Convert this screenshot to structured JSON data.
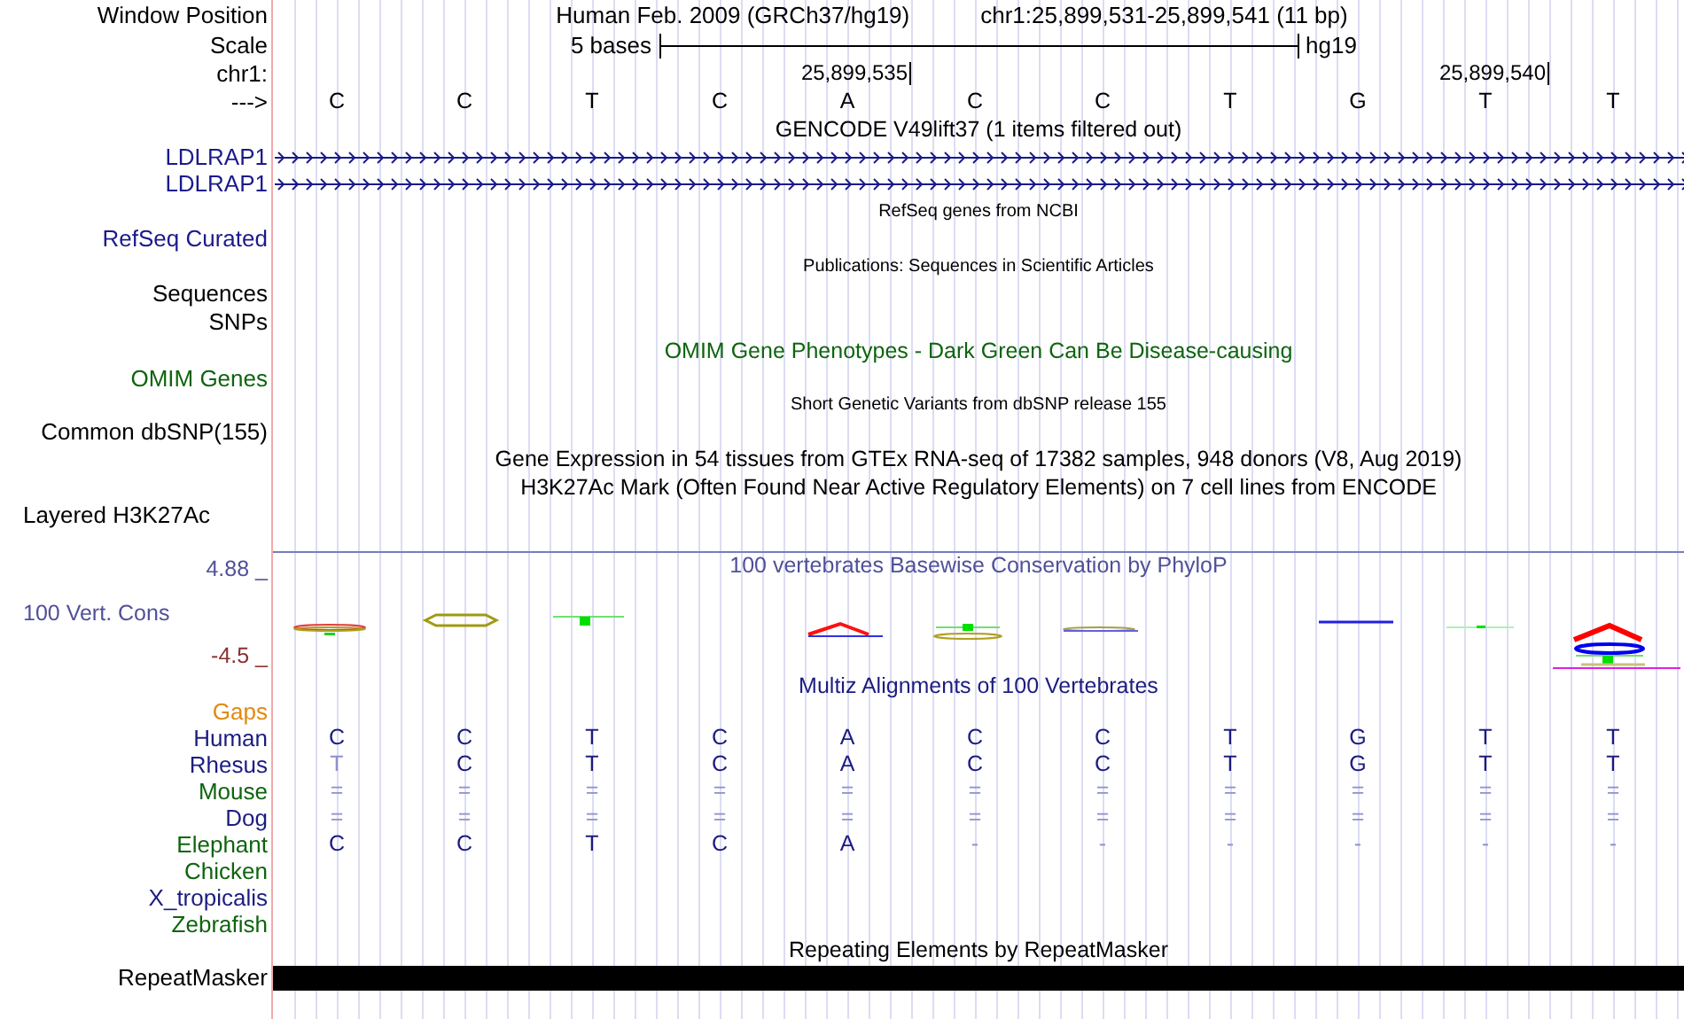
{
  "header": {
    "position_label": "Window Position",
    "assembly": "Human Feb. 2009 (GRCh37/hg19)",
    "range": "chr1:25,899,531-25,899,541 (11 bp)",
    "scale_label": "Scale",
    "scale_text": "5 bases",
    "scale_assembly": "hg19",
    "chrom_label": "chr1:",
    "strand_label": "--->"
  },
  "bases": [
    {
      "base": "C"
    },
    {
      "base": "C"
    },
    {
      "base": "T"
    },
    {
      "base": "C"
    },
    {
      "base": "A",
      "coordinate": "25,899,535"
    },
    {
      "base": "C"
    },
    {
      "base": "C"
    },
    {
      "base": "T"
    },
    {
      "base": "G"
    },
    {
      "base": "T",
      "coordinate": "25,899,540"
    },
    {
      "base": "T"
    }
  ],
  "gencode": {
    "title": "GENCODE V49lift37 (1 items filtered out)",
    "genes": [
      {
        "name": "LDLRAP1"
      },
      {
        "name": "LDLRAP1"
      }
    ]
  },
  "refseq": {
    "title": "RefSeq genes from NCBI",
    "label": "RefSeq Curated"
  },
  "publications": {
    "title": "Publications: Sequences in Scientific Articles",
    "labels": [
      "Sequences",
      "SNPs"
    ]
  },
  "omim": {
    "title": "OMIM Gene Phenotypes - Dark Green Can Be Disease-causing",
    "label": "OMIM Genes"
  },
  "dbsnp": {
    "title": "Short Genetic Variants from dbSNP release 155",
    "label": "Common dbSNP(155)"
  },
  "expression": {
    "titles": [
      "Gene Expression in 54 tissues from GTEx RNA-seq of 17382 samples, 948 donors (V8, Aug 2019)",
      "H3K27Ac Mark (Often Found Near Active Regulatory Elements) on 7 cell lines from ENCODE"
    ],
    "label": "Layered H3K27Ac"
  },
  "conservation": {
    "title": "100 vertebrates Basewise Conservation by PhyloP",
    "label": "100 Vert. Cons",
    "max_label": "4.88 _",
    "min_label": "-4.5 _"
  },
  "alignment": {
    "title": "Multiz Alignments of 100 Vertebrates",
    "gaps_label": "Gaps",
    "species": [
      {
        "name": "Human",
        "color": "#1c1c80",
        "bases": [
          {
            "text": "C",
            "faded": false
          },
          {
            "text": "C",
            "faded": false
          },
          {
            "text": "T",
            "faded": false
          },
          {
            "text": "C",
            "faded": false
          },
          {
            "text": "A",
            "faded": false
          },
          {
            "text": "C",
            "faded": false
          },
          {
            "text": "C",
            "faded": false
          },
          {
            "text": "T",
            "faded": false
          },
          {
            "text": "G",
            "faded": false
          },
          {
            "text": "T",
            "faded": false
          },
          {
            "text": "T",
            "faded": false
          }
        ]
      },
      {
        "name": "Rhesus",
        "color": "#1c1c80",
        "bases": [
          {
            "text": "T",
            "faded": true
          },
          {
            "text": "C",
            "faded": false
          },
          {
            "text": "T",
            "faded": false
          },
          {
            "text": "C",
            "faded": false
          },
          {
            "text": "A",
            "faded": false
          },
          {
            "text": "C",
            "faded": false
          },
          {
            "text": "C",
            "faded": false
          },
          {
            "text": "T",
            "faded": false
          },
          {
            "text": "G",
            "faded": false
          },
          {
            "text": "T",
            "faded": false
          },
          {
            "text": "T",
            "faded": false
          }
        ]
      },
      {
        "name": "Mouse",
        "color": "#0e640e",
        "bases": [
          {
            "text": "=",
            "faded": true
          },
          {
            "text": "=",
            "faded": true
          },
          {
            "text": "=",
            "faded": true
          },
          {
            "text": "=",
            "faded": true
          },
          {
            "text": "=",
            "faded": true
          },
          {
            "text": "=",
            "faded": true
          },
          {
            "text": "=",
            "faded": true
          },
          {
            "text": "=",
            "faded": true
          },
          {
            "text": "=",
            "faded": true
          },
          {
            "text": "=",
            "faded": true
          },
          {
            "text": "=",
            "faded": true
          }
        ]
      },
      {
        "name": "Dog",
        "color": "#1c1c80",
        "bases": [
          {
            "text": "=",
            "faded": true
          },
          {
            "text": "=",
            "faded": true
          },
          {
            "text": "=",
            "faded": true
          },
          {
            "text": "=",
            "faded": true
          },
          {
            "text": "=",
            "faded": true
          },
          {
            "text": "=",
            "faded": true
          },
          {
            "text": "=",
            "faded": true
          },
          {
            "text": "=",
            "faded": true
          },
          {
            "text": "=",
            "faded": true
          },
          {
            "text": "=",
            "faded": true
          },
          {
            "text": "=",
            "faded": true
          }
        ]
      },
      {
        "name": "Elephant",
        "color": "#0e640e",
        "bases": [
          {
            "text": "C",
            "faded": false
          },
          {
            "text": "C",
            "faded": false
          },
          {
            "text": "T",
            "faded": false
          },
          {
            "text": "C",
            "faded": false
          },
          {
            "text": "A",
            "faded": false
          },
          {
            "text": "-",
            "faded": true
          },
          {
            "text": "-",
            "faded": true
          },
          {
            "text": "-",
            "faded": true
          },
          {
            "text": "-",
            "faded": true
          },
          {
            "text": "-",
            "faded": true
          },
          {
            "text": "-",
            "faded": true
          }
        ]
      },
      {
        "name": "Chicken",
        "color": "#0e640e"
      },
      {
        "name": "X_tropicalis",
        "color": "#1c1c80"
      },
      {
        "name": "Zebrafish",
        "color": "#0e640e"
      }
    ]
  },
  "repeats": {
    "title": "Repeating Elements by RepeatMasker",
    "label": "RepeatMasker"
  }
}
